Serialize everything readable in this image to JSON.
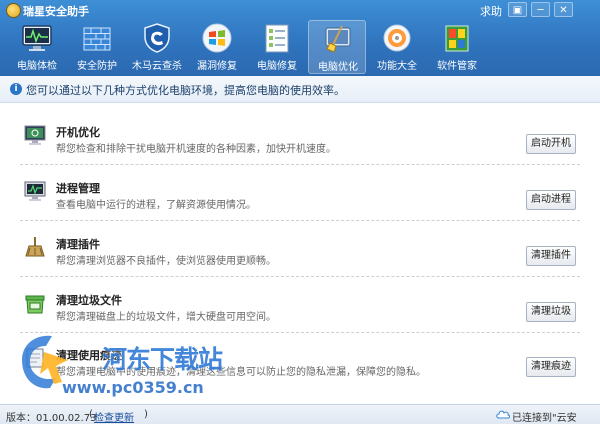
{
  "window": {
    "title": "瑞星安全助手",
    "help": "求助",
    "menu_glyph": "▣",
    "min_glyph": "─",
    "close_glyph": "✕"
  },
  "toolbar": [
    {
      "label": "电脑体检",
      "icon": "monitor-checkup-icon"
    },
    {
      "label": "安全防护",
      "icon": "firewall-icon"
    },
    {
      "label": "木马云查杀",
      "icon": "shield-icon"
    },
    {
      "label": "漏洞修复",
      "icon": "windows-flag-icon"
    },
    {
      "label": "电脑修复",
      "icon": "checklist-icon"
    },
    {
      "label": "电脑优化",
      "icon": "broom-icon",
      "active": true
    },
    {
      "label": "功能大全",
      "icon": "disc-icon"
    },
    {
      "label": "软件管家",
      "icon": "software-blocks-icon"
    }
  ],
  "info": {
    "icon": "i",
    "text": "您可以通过以下几种方式优化电脑环境，提高您电脑的使用效率。"
  },
  "items": [
    {
      "title": "开机优化",
      "desc": "帮您检查和排除干扰电脑开机速度的各种因素，加快开机速度。",
      "button": "启动开机",
      "icon": "boot-monitor-icon"
    },
    {
      "title": "进程管理",
      "desc": "查看电脑中运行的进程，了解资源使用情况。",
      "button": "启动进程",
      "icon": "process-monitor-icon"
    },
    {
      "title": "清理插件",
      "desc": "帮您清理浏览器不良插件，使浏览器使用更顺畅。",
      "button": "清理插件",
      "icon": "plugin-broom-icon"
    },
    {
      "title": "清理垃圾文件",
      "desc": "帮您清理磁盘上的垃圾文件，增大硬盘可用空间。",
      "button": "清理垃圾",
      "icon": "trash-bin-icon"
    },
    {
      "title": "清理使用痕迹",
      "desc": "帮您清理电脑中的使用痕迹，清理这些信息可以防止您的隐私泄漏，保障您的隐私。",
      "button": "清理痕迹",
      "icon": "eraser-icon"
    }
  ],
  "status": {
    "version": "版本：01.00.02.73",
    "open_paren": "(",
    "check_update": "检查更新",
    "close_paren": ")",
    "connection": "已连接到\"云安全\"中心"
  },
  "watermark": {
    "text": "河东下载站",
    "url": "www.pc0359.cn"
  },
  "colors": {
    "titlebar": "#2f73bd",
    "accent": "#2a75c9",
    "watermark": "#2f7ad6"
  }
}
